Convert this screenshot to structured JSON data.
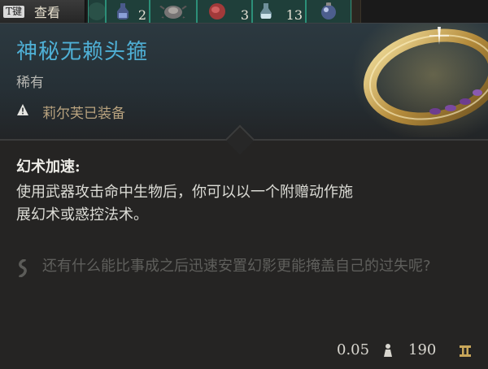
{
  "hotbar": {
    "key_badge": "T键",
    "key_label": "查看",
    "slots": [
      {
        "count": "",
        "icon": "bag-icon"
      },
      {
        "count": "2",
        "icon": "potion-icon"
      },
      {
        "count": "",
        "icon": "spider-icon"
      },
      {
        "count": "3",
        "icon": "meat-icon"
      },
      {
        "count": "13",
        "icon": "flask-icon"
      },
      {
        "count": "",
        "icon": "orb-icon"
      }
    ]
  },
  "item": {
    "name": "神秘无赖头箍",
    "rarity": "稀有",
    "equipped_by": "莉尔芙已装备",
    "passive_title": "幻术加速:",
    "passive_desc": "使用武器攻击命中生物后，你可以以一个附赠动作施展幻术或惑控法术。",
    "flavor": "还有什么能比事成之后迅速安置幻影更能掩盖自己的过失呢?",
    "weight": "0.05",
    "value": "190"
  },
  "colors": {
    "name": "#4fb0d6",
    "equip": "#b9a37f",
    "flavor": "#5f5f5c",
    "slot_border": "#2c8f78"
  }
}
